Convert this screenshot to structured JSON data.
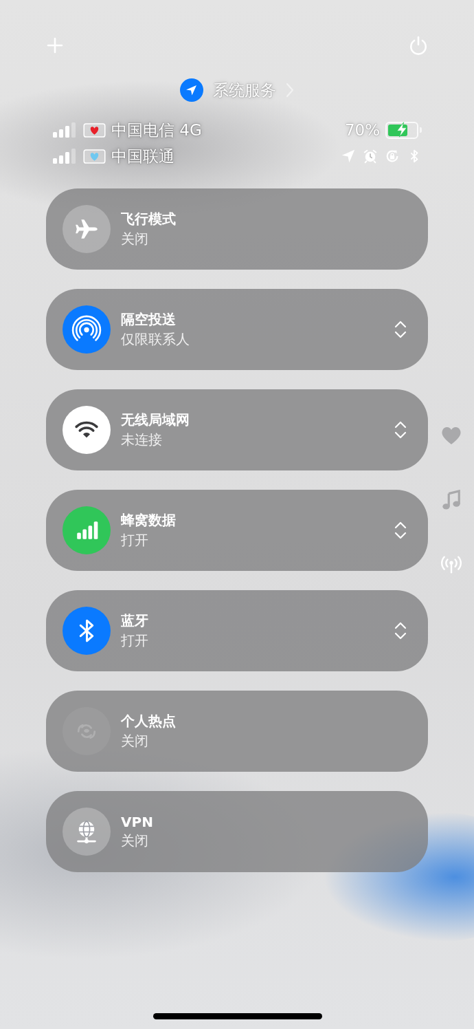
{
  "header": {
    "location_label": "系统服务"
  },
  "carriers": [
    {
      "name": "中国电信 4G",
      "color": "#e8202a"
    },
    {
      "name": "中国联通",
      "color": "#6fc8f0"
    }
  ],
  "battery": {
    "percent": "70%",
    "level": 0.7,
    "charging": true
  },
  "toggles": [
    {
      "kind": "airplane",
      "title": "飞行模式",
      "status": "关闭",
      "on": false,
      "disabled": false,
      "expandable": false
    },
    {
      "kind": "airdrop",
      "title": "隔空投送",
      "status": "仅限联系人",
      "on": true,
      "color": "#0a7aff",
      "disabled": false,
      "expandable": true
    },
    {
      "kind": "wifi",
      "title": "无线局域网",
      "status": "未连接",
      "on": true,
      "color": "#ffffff",
      "disabled": false,
      "expandable": true
    },
    {
      "kind": "cellular",
      "title": "蜂窝数据",
      "status": "打开",
      "on": true,
      "color": "#30c659",
      "disabled": false,
      "expandable": true
    },
    {
      "kind": "bluetooth",
      "title": "蓝牙",
      "status": "打开",
      "on": true,
      "color": "#0a7aff",
      "disabled": false,
      "expandable": true
    },
    {
      "kind": "hotspot",
      "title": "个人热点",
      "status": "关闭",
      "on": false,
      "disabled": true,
      "expandable": false
    },
    {
      "kind": "vpn",
      "title": "VPN",
      "status": "关闭",
      "on": false,
      "disabled": false,
      "expandable": false
    }
  ],
  "side_pages": [
    {
      "kind": "heart",
      "selected": false
    },
    {
      "kind": "music",
      "selected": false
    },
    {
      "kind": "antenna",
      "selected": true
    }
  ]
}
